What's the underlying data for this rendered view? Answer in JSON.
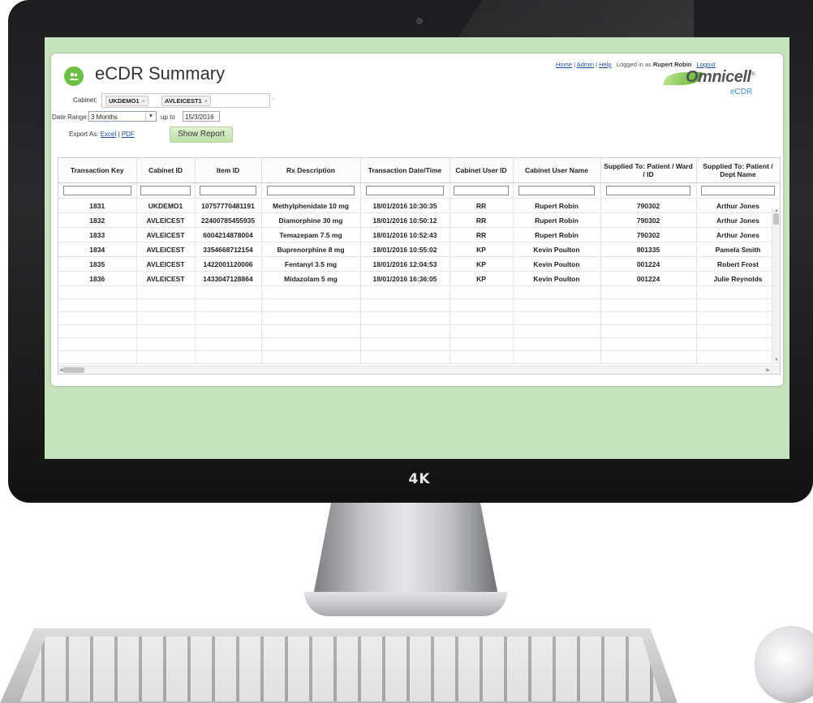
{
  "device": {
    "badge": "4K"
  },
  "app": {
    "title": "eCDR Summary",
    "nav": {
      "home": "Home",
      "admin": "Admin",
      "help": "Help",
      "sep": "|",
      "logged_in_as": "Logged in as",
      "user": "Rupert Robin",
      "logout": "Logout"
    },
    "logo": {
      "name": "Omnicell",
      "registered": "®",
      "sub": "eCDR"
    },
    "filters": {
      "cabinet_label": "Cabinet:",
      "cabinets": [
        "UKDEMO1",
        "AVLEICEST1"
      ],
      "chip_remove": "×",
      "date_range_label": "Date Range:",
      "date_range_value": "3 Months",
      "up_to_label": "up to",
      "up_to_value": "15/3/2016",
      "export_label": "Export As:",
      "export_excel": "Excel",
      "export_pdf": "PDF",
      "show_report": "Show Report"
    },
    "grid": {
      "columns": [
        "Transaction Key",
        "Cabinet ID",
        "Item ID",
        "Rx Description",
        "Transaction Date/Time",
        "Cabinet User ID",
        "Cabinet User Name",
        "Supplied To: Patient / Ward / ID",
        "Supplied To: Patient / Dept Name"
      ],
      "rows": [
        [
          "1831",
          "UKDEMO1",
          "10757770481191",
          "Methylphenidate 10 mg",
          "18/01/2016 10:30:35",
          "RR",
          "Rupert Robin",
          "790302",
          "Arthur Jones"
        ],
        [
          "1832",
          "AVLEICEST",
          "22400785455935",
          "Diamorphine  30 mg",
          "18/01/2016 10:50:12",
          "RR",
          "Rupert Robin",
          "790302",
          "Arthur Jones"
        ],
        [
          "1833",
          "AVLEICEST",
          "6004214878004",
          "Temazepam 7.5 mg",
          "18/01/2016 10:52:43",
          "RR",
          "Rupert Robin",
          "790302",
          "Arthur Jones"
        ],
        [
          "1834",
          "AVLEICEST",
          "3354668712154",
          "Buprenorphine 8 mg",
          "18/01/2016 10:55:02",
          "KP",
          "Kevin Poulton",
          "801335",
          "Pamela Smith"
        ],
        [
          "1835",
          "AVLEICEST",
          "1422001120006",
          "Fentanyl 3.5 mg",
          "18/01/2016 12:04:53",
          "KP",
          "Kevin Poulton",
          "001224",
          "Robert Frost"
        ],
        [
          "1836",
          "AVLEICEST",
          "1433047128864",
          "Midazolam 5 mg",
          "18/01/2016 16:36:05",
          "KP",
          "Kevin Poulton",
          "001224",
          "Julie Reynolds"
        ]
      ]
    }
  }
}
